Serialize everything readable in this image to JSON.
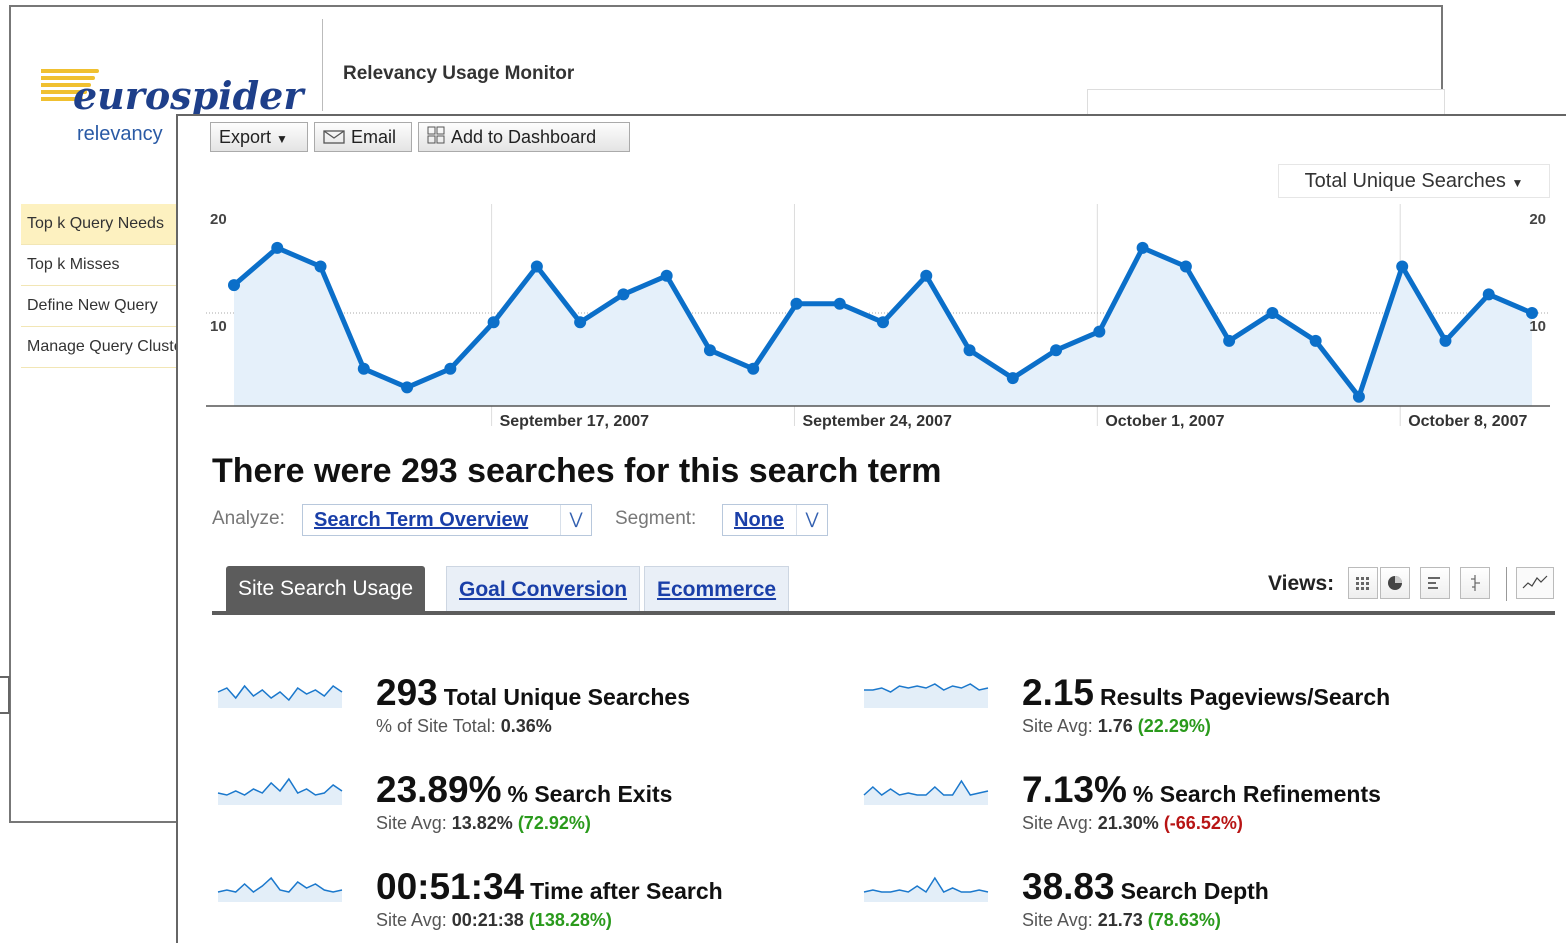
{
  "background_window": {
    "title": "Relevancy Usage Monitor",
    "logo_word": "eurospider",
    "logo_sub": "relevancy",
    "nav": [
      {
        "label": "Top k Query Needs",
        "active": true
      },
      {
        "label": "Top k Misses",
        "active": false
      },
      {
        "label": "Define New Query",
        "active": false
      },
      {
        "label": "Manage Query Clusters",
        "active": false
      }
    ]
  },
  "toolbar": {
    "export_label": "Export",
    "email_label": "Email",
    "dashboard_label": "Add to Dashboard"
  },
  "metric_select": "Total Unique Searches",
  "chart_data": {
    "type": "area",
    "series": [
      {
        "name": "Total Unique Searches",
        "values": [
          13,
          17,
          15,
          4,
          2,
          4,
          9,
          15,
          9,
          12,
          14,
          6,
          4,
          11,
          11,
          9,
          14,
          6,
          3,
          6,
          8,
          17,
          15,
          7,
          10,
          7,
          1,
          15,
          7,
          12,
          10
        ]
      }
    ],
    "ylim": [
      0,
      20
    ],
    "y_ticks_left": [
      {
        "value": 20,
        "label": "20"
      },
      {
        "value": 10,
        "label": "10"
      }
    ],
    "y_ticks_right": [
      {
        "value": 20,
        "label": "20"
      },
      {
        "value": 10,
        "label": "10"
      }
    ],
    "x_ticks": [
      {
        "index": 6,
        "label": "September 17, 2007"
      },
      {
        "index": 13,
        "label": "September 24, 2007"
      },
      {
        "index": 20,
        "label": "October 1, 2007"
      },
      {
        "index": 27,
        "label": "October 8, 2007"
      }
    ],
    "line_color": "#0b6fc9",
    "fill_color": "#e5f0fa"
  },
  "headline": "There were 293 searches for this search term",
  "analyze": {
    "label": "Analyze:",
    "value": "Search Term Overview"
  },
  "segment": {
    "label": "Segment:",
    "value": "None"
  },
  "tabs": [
    {
      "label": "Site Search Usage",
      "active": true
    },
    {
      "label": "Goal Conversion",
      "active": false
    },
    {
      "label": "Ecommerce",
      "active": false
    }
  ],
  "views_label": "Views:",
  "metrics": [
    {
      "value": "293",
      "name": "Total Unique Searches",
      "sub_label": "% of Site Total:",
      "sub_value": "0.36%",
      "change": "",
      "spark": [
        6,
        4,
        9,
        3,
        8,
        5,
        9,
        6,
        10,
        4,
        7,
        5,
        8,
        3,
        6
      ]
    },
    {
      "value": "2.15",
      "name": "Results Pageviews/Search",
      "sub_label": "Site Avg:",
      "sub_value": "1.76",
      "change": "(22.29%)",
      "change_sign": "pos",
      "spark": [
        5,
        5,
        4,
        6,
        3,
        4,
        3,
        4,
        2,
        5,
        3,
        4,
        2,
        5,
        4
      ]
    },
    {
      "value": "23.89%",
      "name": "% Search Exits",
      "sub_label": "Site Avg:",
      "sub_value": "13.82%",
      "change": "(72.92%)",
      "change_sign": "pos",
      "spark": [
        8,
        9,
        7,
        9,
        6,
        8,
        3,
        7,
        1,
        8,
        6,
        9,
        8,
        4,
        7
      ]
    },
    {
      "value": "7.13%",
      "name": "% Search Refinements",
      "sub_label": "Site Avg:",
      "sub_value": "21.30%",
      "change": "(-66.52%)",
      "change_sign": "neg",
      "spark": [
        9,
        5,
        9,
        6,
        9,
        8,
        9,
        9,
        5,
        9,
        9,
        2,
        9,
        8,
        7
      ]
    },
    {
      "value": "00:51:34",
      "name": "Time after Search",
      "sub_label": "Site Avg:",
      "sub_value": "00:21:38",
      "change": "(138.28%)",
      "change_sign": "pos",
      "spark": [
        9,
        8,
        9,
        5,
        9,
        6,
        2,
        8,
        9,
        4,
        7,
        5,
        8,
        9,
        8
      ]
    },
    {
      "value": "38.83",
      "name": "Search Depth",
      "sub_label": "Site Avg:",
      "sub_value": "21.73",
      "change": "(78.63%)",
      "change_sign": "pos",
      "spark": [
        9,
        8,
        9,
        9,
        8,
        9,
        6,
        9,
        2,
        9,
        7,
        9,
        9,
        8,
        9
      ]
    }
  ]
}
